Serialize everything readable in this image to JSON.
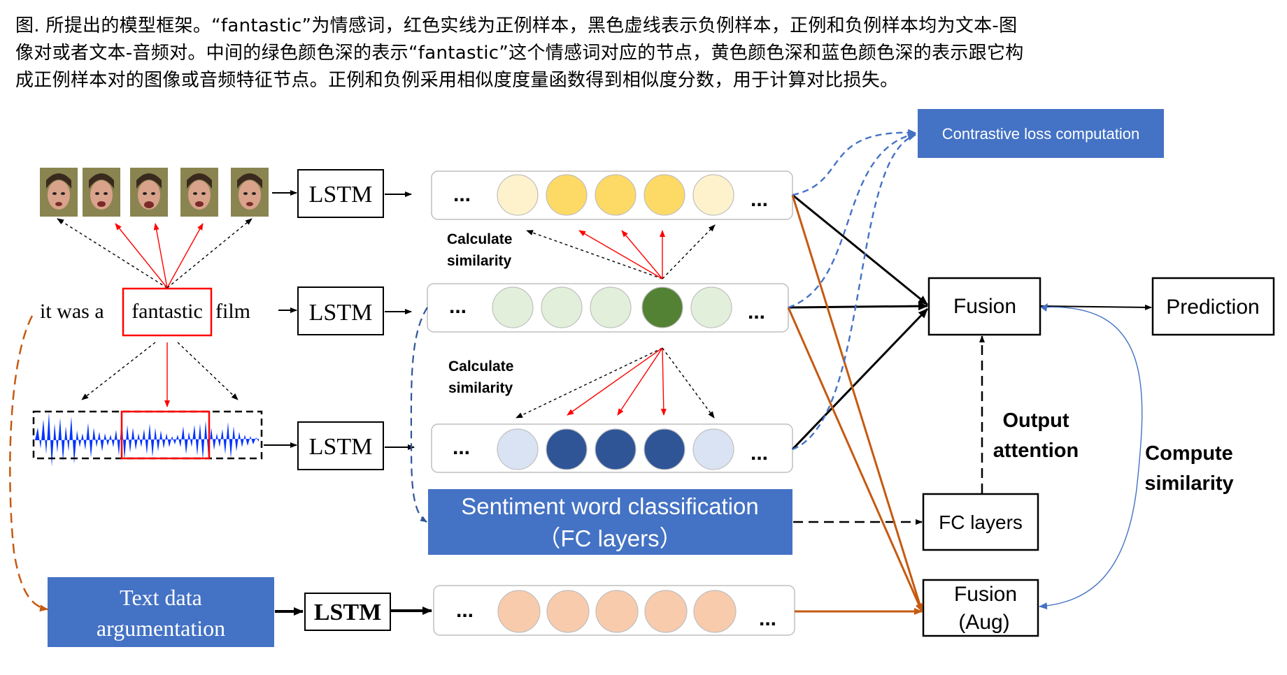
{
  "caption": {
    "lines": [
      "图. 所提出的模型框架。“fantastic”为情感词，红色实线为正例样本，黑色虚线表示负例样本，正例和负例样本均为文本-图",
      "像对或者文本-音频对。中间的绿色颜色深的表示“fantastic”这个情感词对应的节点，黄色颜色深和蓝色颜色深的表示跟它构",
      "成正例样本对的图像或音频特征节点。正例和负例采用相似度度量函数得到相似度分数，用于计算对比损失。"
    ]
  },
  "diagram": {
    "sentence": {
      "prefix": "it was a",
      "word": "fantastic",
      "suffix": "film"
    },
    "lstm_label": "LSTM",
    "ellipsis": "...",
    "calc_similarity": {
      "line1": "Calculate",
      "line2": "similarity"
    },
    "contrastive_loss": "Contrastive loss computation",
    "fusion": "Fusion",
    "prediction": "Prediction",
    "fc_layers": "FC layers",
    "fusion_aug": {
      "line1": "Fusion",
      "line2": "(Aug)"
    },
    "output_attention": {
      "line1": "Output",
      "line2": "attention"
    },
    "compute_similarity": {
      "line1": "Compute",
      "line2": "similarity"
    },
    "sentiment_classification": {
      "line1": "Sentiment word classification",
      "line2": "（FC layers）"
    },
    "text_aug": {
      "line1": "Text data",
      "line2": "argumentation"
    },
    "colors": {
      "visual_light": "#FEF2CC",
      "visual_dark": "#FDD966",
      "text_light": "#E2EFDA",
      "text_dark": "#548235",
      "audio_light": "#DAE3F3",
      "audio_dark": "#2F5597",
      "aug_node": "#F8CBAD",
      "blue_box": "#4472C4",
      "positive_arrow": "#FF0000",
      "aug_arrow": "#C55A11"
    }
  }
}
